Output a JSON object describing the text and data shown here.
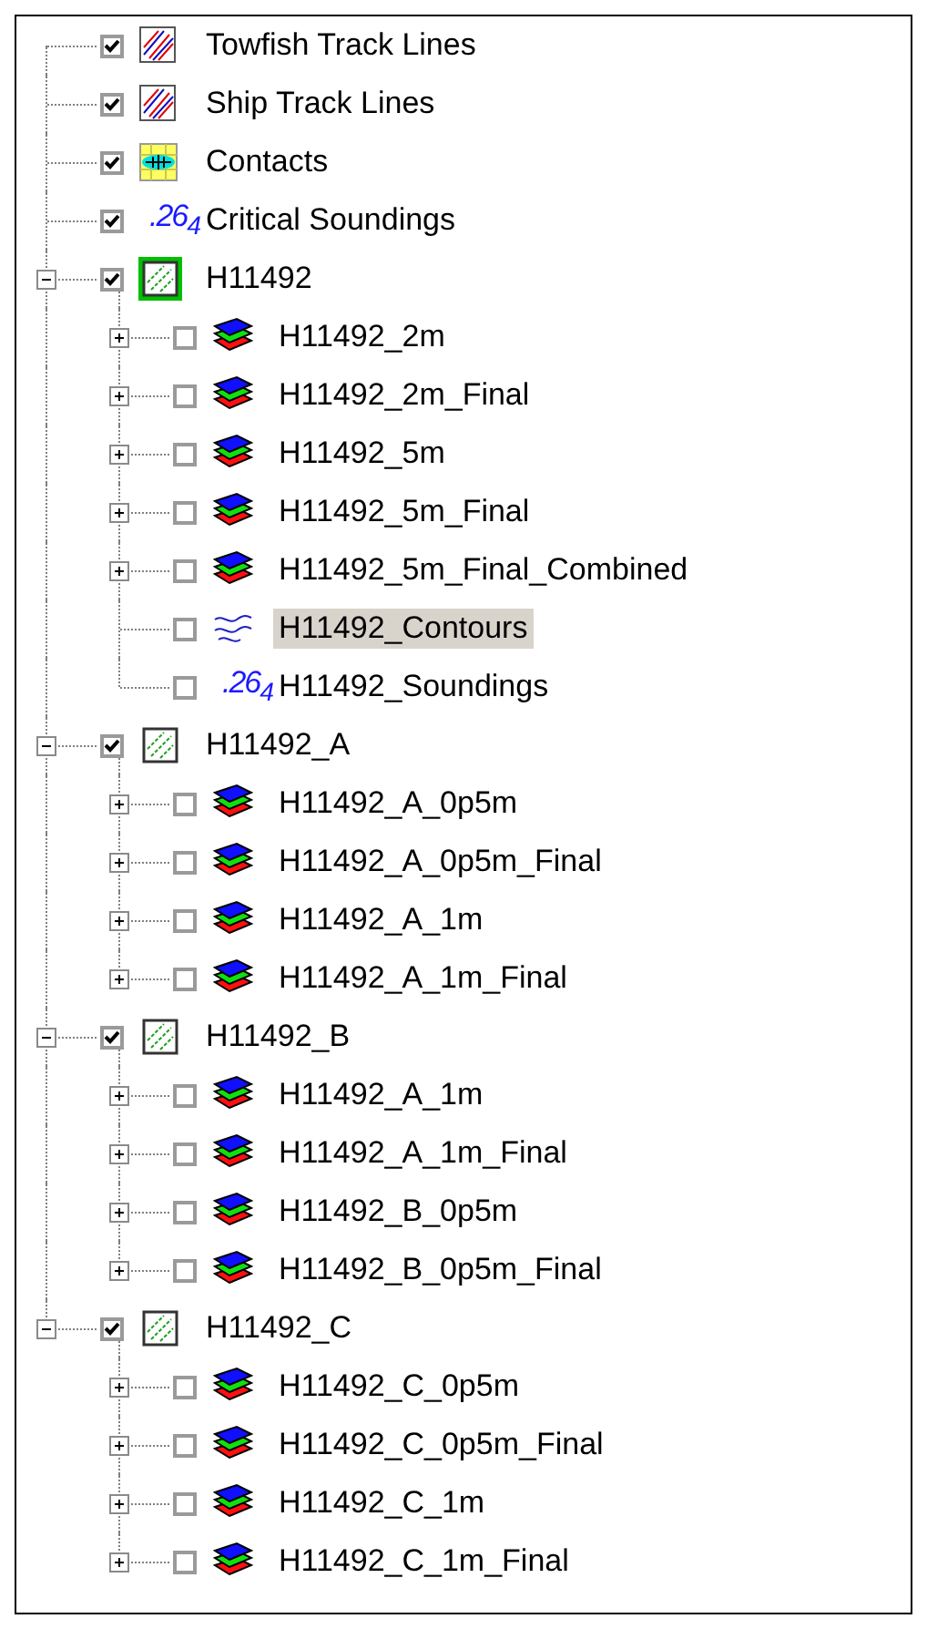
{
  "layers": [
    {
      "label": "Towfish Track Lines",
      "kind": "track",
      "checked": true,
      "selected": false
    },
    {
      "label": "Ship Track Lines",
      "kind": "track",
      "checked": true,
      "selected": false
    },
    {
      "label": "Contacts",
      "kind": "contacts",
      "checked": true,
      "selected": false
    },
    {
      "label": "Critical Soundings",
      "kind": "soundings",
      "badge": ".26$_{4}$",
      "checked": true,
      "selected": false
    },
    {
      "label": "H11492",
      "kind": "survey",
      "active": true,
      "checked": true,
      "selected": false,
      "expanded": true,
      "children": [
        {
          "label": "H11492_2m",
          "kind": "surface",
          "checked": false,
          "selected": false,
          "expanded": false
        },
        {
          "label": "H11492_2m_Final",
          "kind": "surface",
          "checked": false,
          "selected": false,
          "expanded": false
        },
        {
          "label": "H11492_5m",
          "kind": "surface",
          "checked": false,
          "selected": false,
          "expanded": false
        },
        {
          "label": "H11492_5m_Final",
          "kind": "surface",
          "checked": false,
          "selected": false,
          "expanded": false
        },
        {
          "label": "H11492_5m_Final_Combined",
          "kind": "surface",
          "checked": false,
          "selected": false,
          "expanded": false
        },
        {
          "label": "H11492_Contours",
          "kind": "contours",
          "checked": false,
          "selected": true
        },
        {
          "label": "H11492_Soundings",
          "kind": "soundings",
          "badge": ".26$_{4}$",
          "checked": false,
          "selected": false
        }
      ]
    },
    {
      "label": "H11492_A",
      "kind": "survey",
      "active": false,
      "checked": true,
      "selected": false,
      "expanded": true,
      "children": [
        {
          "label": "H11492_A_0p5m",
          "kind": "surface",
          "checked": false,
          "selected": false,
          "expanded": false
        },
        {
          "label": "H11492_A_0p5m_Final",
          "kind": "surface",
          "checked": false,
          "selected": false,
          "expanded": false
        },
        {
          "label": "H11492_A_1m",
          "kind": "surface",
          "checked": false,
          "selected": false,
          "expanded": false
        },
        {
          "label": "H11492_A_1m_Final",
          "kind": "surface",
          "checked": false,
          "selected": false,
          "expanded": false
        }
      ]
    },
    {
      "label": "H11492_B",
      "kind": "survey",
      "active": false,
      "checked": true,
      "selected": false,
      "expanded": true,
      "children": [
        {
          "label": "H11492_A_1m",
          "kind": "surface",
          "checked": false,
          "selected": false,
          "expanded": false
        },
        {
          "label": "H11492_A_1m_Final",
          "kind": "surface",
          "checked": false,
          "selected": false,
          "expanded": false
        },
        {
          "label": "H11492_B_0p5m",
          "kind": "surface",
          "checked": false,
          "selected": false,
          "expanded": false
        },
        {
          "label": "H11492_B_0p5m_Final",
          "kind": "surface",
          "checked": false,
          "selected": false,
          "expanded": false
        }
      ]
    },
    {
      "label": "H11492_C",
      "kind": "survey",
      "active": false,
      "checked": true,
      "selected": false,
      "expanded": true,
      "children": [
        {
          "label": "H11492_C_0p5m",
          "kind": "surface",
          "checked": false,
          "selected": false,
          "expanded": false
        },
        {
          "label": "H11492_C_0p5m_Final",
          "kind": "surface",
          "checked": false,
          "selected": false,
          "expanded": false
        },
        {
          "label": "H11492_C_1m",
          "kind": "surface",
          "checked": false,
          "selected": false,
          "expanded": false
        },
        {
          "label": "H11492_C_1m_Final",
          "kind": "surface",
          "checked": false,
          "selected": false,
          "expanded": false
        }
      ]
    }
  ]
}
